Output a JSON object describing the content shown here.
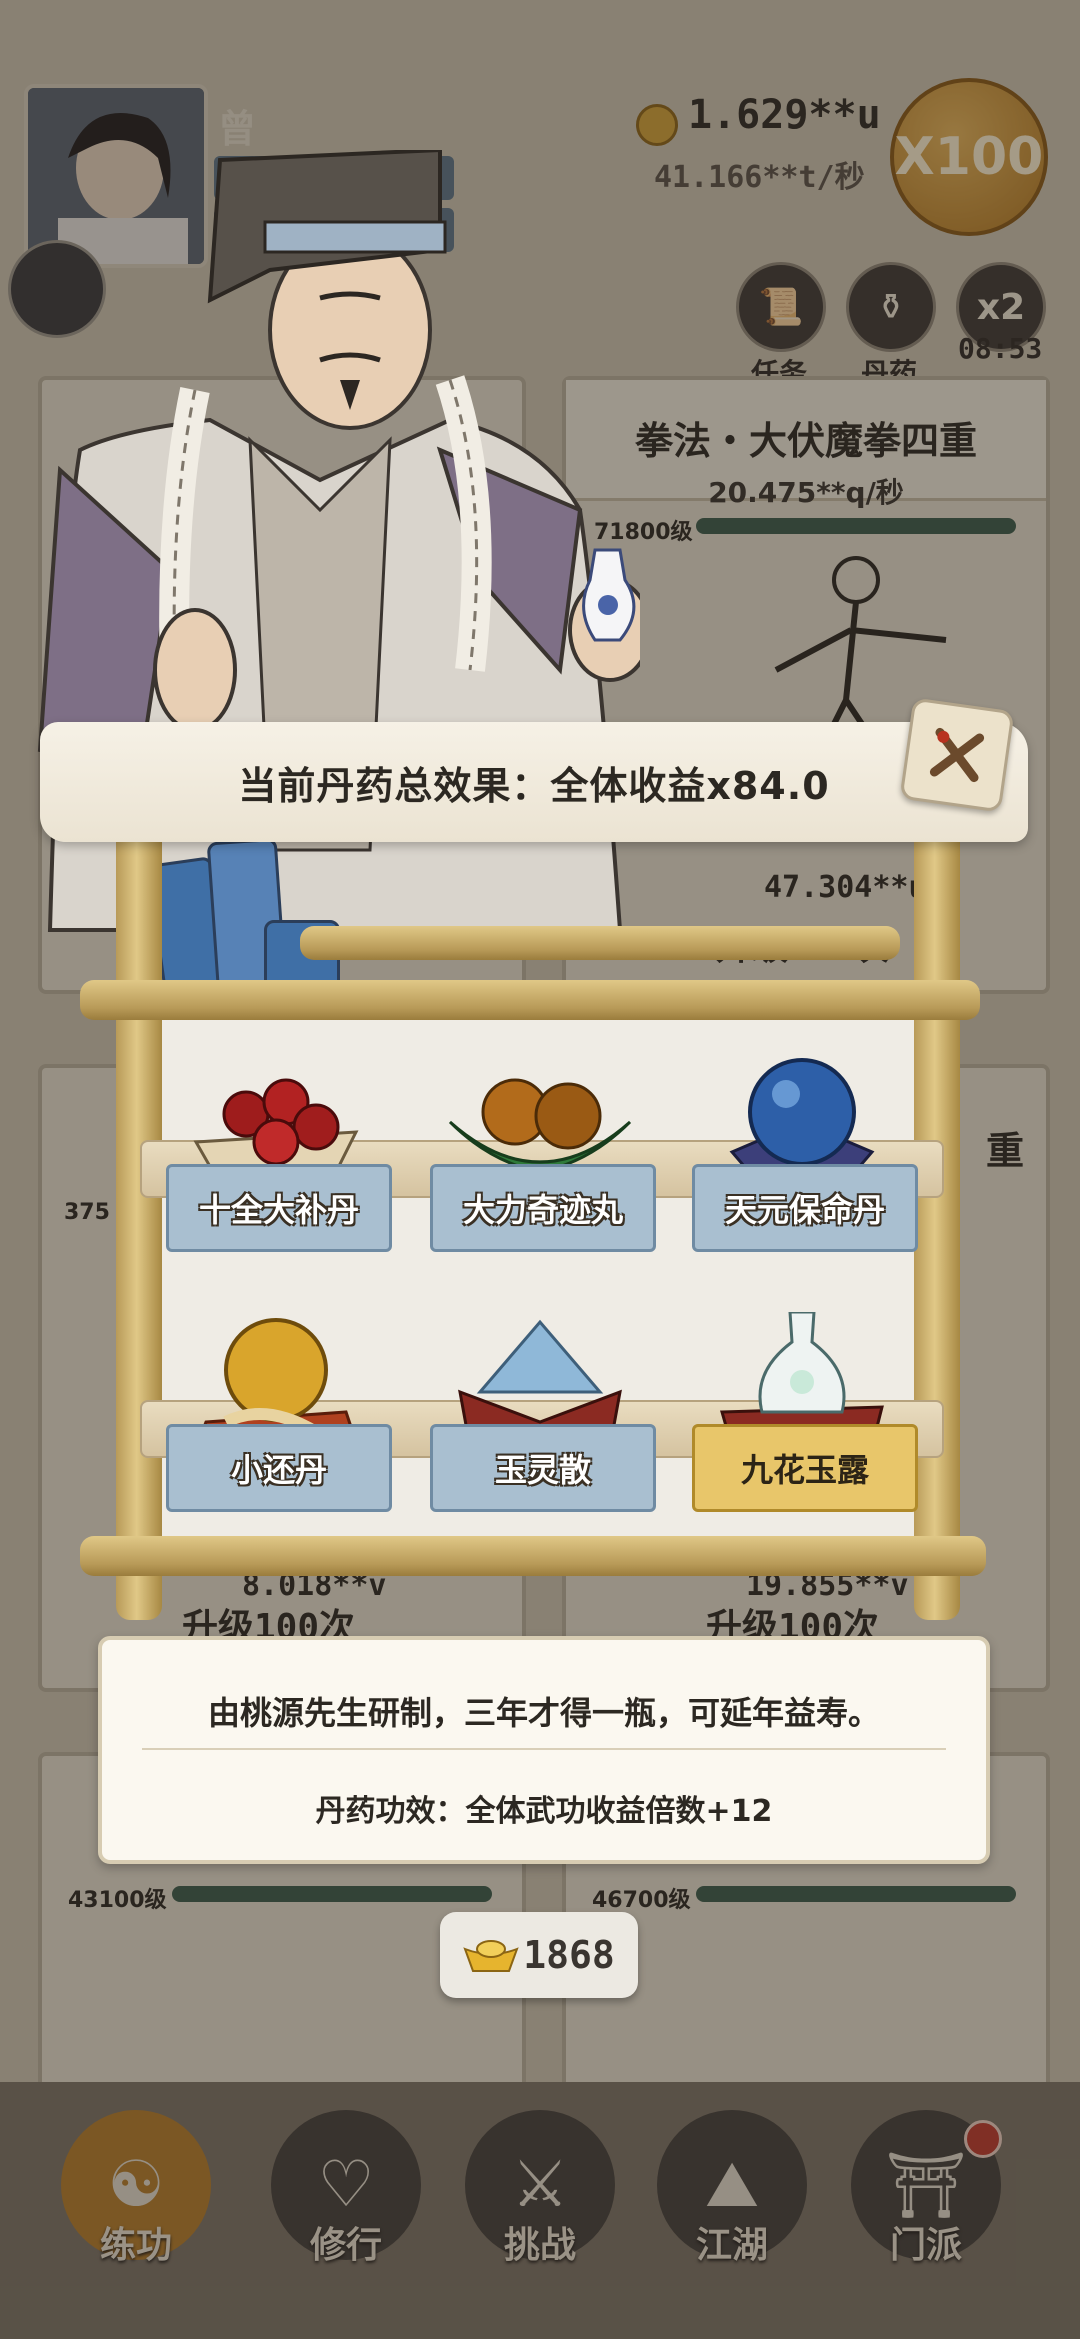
{
  "player": {
    "name": "曾"
  },
  "currency": {
    "value": "1.629**u",
    "rate": "41.166**t/秒"
  },
  "multiplier_button": "X100",
  "tools": [
    {
      "label": "任务"
    },
    {
      "label": "丹药"
    },
    {
      "label": "x2",
      "timer": "08:53"
    }
  ],
  "skill_cards": [
    {
      "title": "拳法・大伏魔拳四重",
      "rate": "20.475**q/秒",
      "level": "71800级",
      "price": "47.304**u",
      "upgrade": "升级100次"
    },
    {
      "level": "375",
      "suffix": "重"
    },
    {
      "price": "8.018**v",
      "upgrade": "升级100次"
    },
    {
      "price": "19.855**v",
      "upgrade": "升级100次"
    },
    {
      "level": "43100级"
    },
    {
      "level": "46700级"
    }
  ],
  "banner": {
    "text": "当前丹药总效果：全体收益x84.0"
  },
  "pills": [
    {
      "name": "十全大补丹",
      "selected": false
    },
    {
      "name": "大力奇迹丸",
      "selected": false
    },
    {
      "name": "天元保命丹",
      "selected": false
    },
    {
      "name": "小还丹",
      "selected": false
    },
    {
      "name": "玉灵散",
      "selected": false
    },
    {
      "name": "九花玉露",
      "selected": true
    }
  ],
  "description": {
    "text": "由桃源先生研制，三年才得一瓶，可延年益寿。",
    "effect": "丹药功效：全体武功收益倍数+12"
  },
  "ingot": {
    "count": "1868"
  },
  "nav": [
    {
      "label": "练功",
      "active": true
    },
    {
      "label": "修行",
      "active": false
    },
    {
      "label": "挑战",
      "active": false
    },
    {
      "label": "江湖",
      "active": false
    },
    {
      "label": "门派",
      "active": false
    }
  ],
  "colors": {
    "accent": "#b77e2a",
    "selected_label": "#e8c66a",
    "label_blue": "#a9bfd0"
  }
}
